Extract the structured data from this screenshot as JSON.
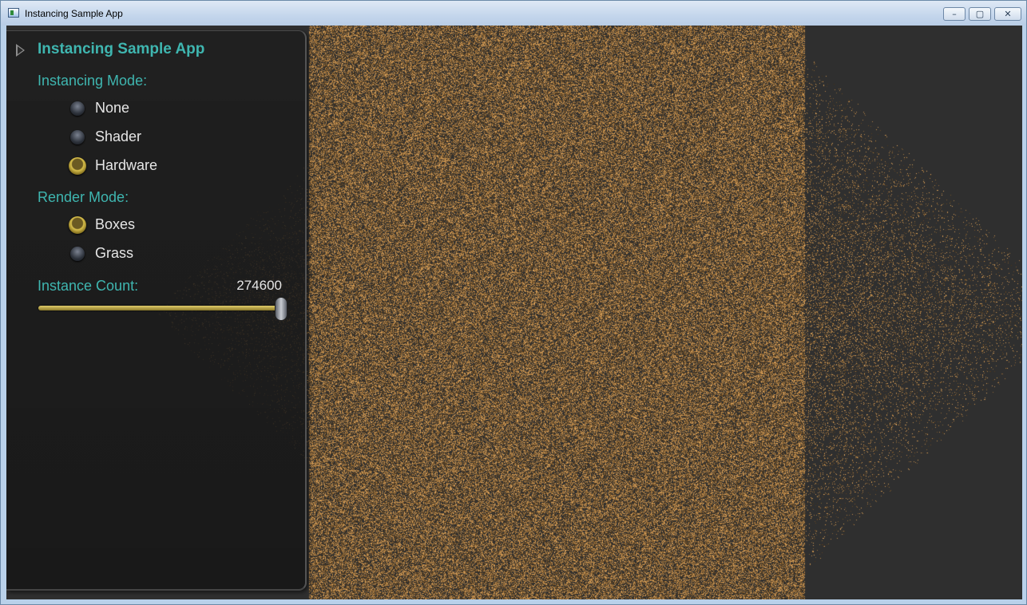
{
  "window": {
    "title": "Instancing Sample App",
    "buttons": {
      "minimize": "–",
      "maximize": "▢",
      "close": "✕"
    }
  },
  "panel": {
    "title": "Instancing Sample App",
    "instancing_mode": {
      "label": "Instancing Mode:",
      "options": [
        "None",
        "Shader",
        "Hardware"
      ],
      "selected": "Hardware"
    },
    "render_mode": {
      "label": "Render Mode:",
      "options": [
        "Boxes",
        "Grass"
      ],
      "selected": "Boxes"
    },
    "instance_count": {
      "label": "Instance Count:",
      "value": "274600",
      "slider_fraction": 1.0
    }
  },
  "colors": {
    "accent": "#3fb6b0",
    "particle_base": "#6b4a22",
    "particle_highlight": "#d9ad66",
    "background": "#2f2f2f"
  },
  "icons": {
    "panel_toggle": "triangle-right-icon",
    "app": "window-app-icon"
  }
}
